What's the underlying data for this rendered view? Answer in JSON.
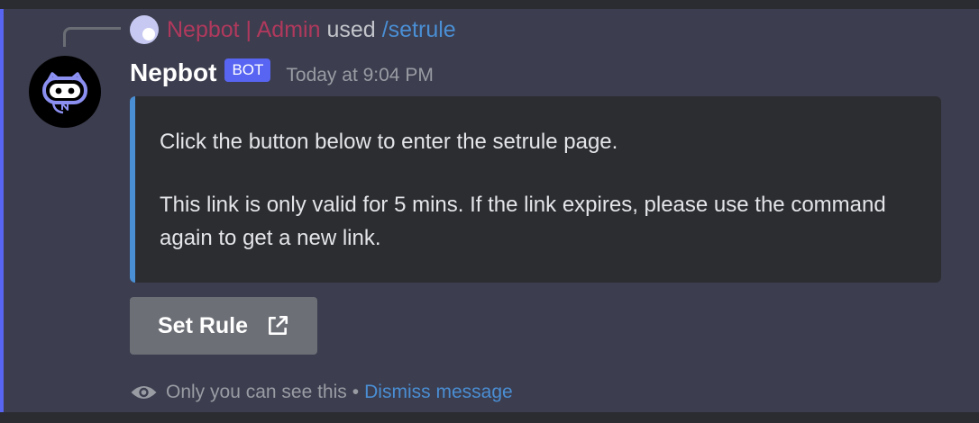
{
  "reply": {
    "username": "Nepbot | Admin",
    "used_text": "used",
    "command": "/setrule"
  },
  "message": {
    "author": "Nepbot",
    "bot_tag": "BOT",
    "timestamp": "Today at 9:04 PM"
  },
  "embed": {
    "line1": "Click the button below to enter the setrule page.",
    "line2": "This link is only valid for 5 mins. If the link expires, please use the command again to get a new link.",
    "accent_color": "#4a8ed4"
  },
  "button": {
    "label": "Set Rule",
    "icon": "external-link-icon"
  },
  "ephemeral": {
    "icon": "eye-icon",
    "text": "Only you can see this",
    "separator": "•",
    "dismiss_label": "Dismiss message"
  },
  "colors": {
    "blurple": "#5865f2",
    "link": "#4a8ed4",
    "reply_user": "#b0395d"
  }
}
